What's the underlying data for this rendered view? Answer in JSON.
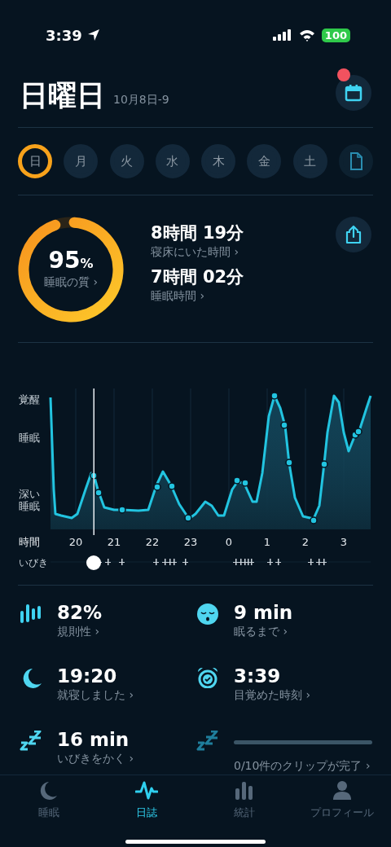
{
  "status_bar": {
    "time": "3:39",
    "battery": "100"
  },
  "header": {
    "title": "日曜日",
    "date": "10月8日-9",
    "notification": true
  },
  "days": [
    {
      "label": "日",
      "selected": true
    },
    {
      "label": "月",
      "selected": false
    },
    {
      "label": "火",
      "selected": false
    },
    {
      "label": "水",
      "selected": false
    },
    {
      "label": "木",
      "selected": false
    },
    {
      "label": "金",
      "selected": false
    },
    {
      "label": "土",
      "selected": false
    }
  ],
  "quality": {
    "value": "95",
    "unit": "%",
    "label": "睡眠の質 ›",
    "level": 0.95
  },
  "durations": [
    {
      "value": "8時間 19分",
      "label": "寝床にいた時間 ›"
    },
    {
      "value": "7時間 02分",
      "label": "睡眠時間 ›"
    }
  ],
  "chart": {
    "y_labels": [
      "覚醒",
      "睡眠",
      "深い睡眠"
    ],
    "x_title": "時間",
    "x_labels": [
      "20",
      "21",
      "22",
      "23",
      "0",
      "1",
      "2",
      "3"
    ],
    "snore_label": "いびき"
  },
  "metrics": [
    {
      "kind": "regularity",
      "value": "82%",
      "label": "規則性 ›"
    },
    {
      "kind": "latency",
      "value": "9 min",
      "label": "眠るまで ›"
    },
    {
      "kind": "bedtime",
      "value": "19:20",
      "label": "就寝しました ›"
    },
    {
      "kind": "wakeup",
      "value": "3:39",
      "label": "目覚めた時刻 ›"
    },
    {
      "kind": "snoring",
      "value": "16 min",
      "label": "いびきをかく ›"
    },
    {
      "kind": "clips",
      "label": "0/10件のクリップが完了 ›",
      "level": 0
    }
  ],
  "tabs": [
    {
      "kind": "sleep",
      "label": "睡眠",
      "selected": false
    },
    {
      "kind": "journal",
      "label": "日誌",
      "selected": true
    },
    {
      "kind": "stats",
      "label": "統計",
      "selected": false
    },
    {
      "kind": "profile",
      "label": "プロフィール",
      "selected": false
    }
  ]
}
